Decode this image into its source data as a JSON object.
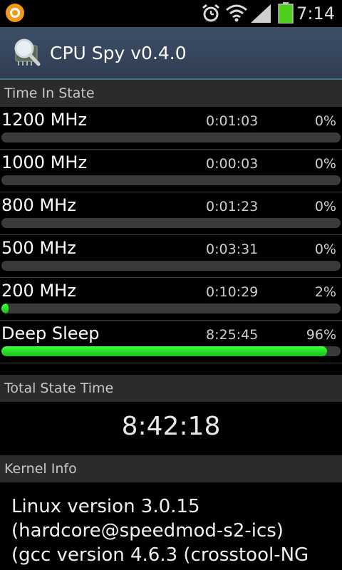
{
  "status_bar": {
    "time": "7:14",
    "icons": [
      "app-notification-icon",
      "alarm-icon",
      "wifi-icon",
      "signal-icon",
      "battery-icon"
    ],
    "battery_color": "#4cd01c"
  },
  "app": {
    "title": "CPU Spy v0.4.0",
    "icon": "magnifier-chip-icon"
  },
  "sections": {
    "time_in_state": "Time In State",
    "total_state_time": "Total State Time",
    "kernel_info": "Kernel Info"
  },
  "states": [
    {
      "name": "1200 MHz",
      "time": "0:01:03",
      "percent": "0%",
      "fill": 0
    },
    {
      "name": "1000 MHz",
      "time": "0:00:03",
      "percent": "0%",
      "fill": 0
    },
    {
      "name": "800 MHz",
      "time": "0:01:23",
      "percent": "0%",
      "fill": 0
    },
    {
      "name": "500 MHz",
      "time": "0:03:31",
      "percent": "0%",
      "fill": 0
    },
    {
      "name": "200 MHz",
      "time": "0:10:29",
      "percent": "2%",
      "fill": 0.02
    },
    {
      "name": "Deep Sleep",
      "time": "8:25:45",
      "percent": "96%",
      "fill": 0.96
    }
  ],
  "total_state_time": "8:42:18",
  "kernel_lines": [
    "Linux version 3.0.15",
    "(hardcore@speedmod-s2-ics)",
    "(gcc version 4.6.3 (crosstool-NG"
  ],
  "colors": {
    "bar_fill": "#22dd22",
    "title_bar": "#34445a",
    "section_header": "#2b2b2b"
  }
}
